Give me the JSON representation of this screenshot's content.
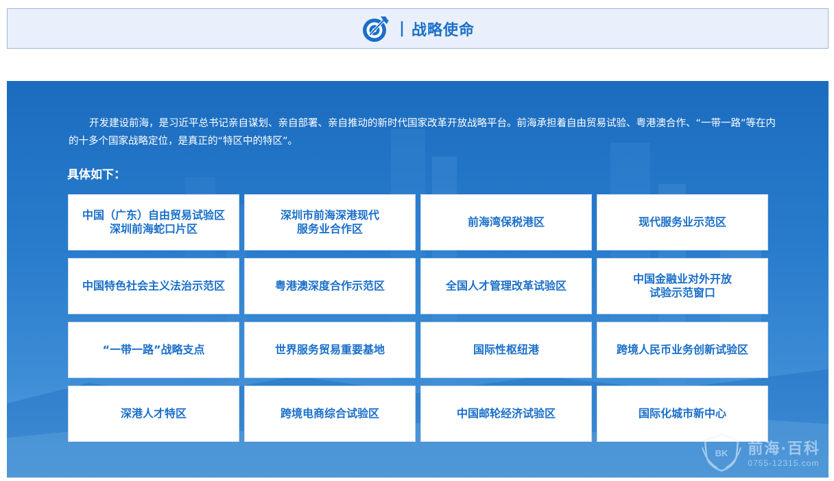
{
  "header": {
    "icon": "target-arrow-icon",
    "separator": "|",
    "title": "战略使命"
  },
  "intro": {
    "paragraph": "开发建设前海，是习近平总书记亲自谋划、亲自部署、亲自推动的新时代国家改革开放战略平台。前海承担着自由贸易试验、粤港澳合作、“一带一路”等在内的十多个国家战略定位，是真正的“特区中的特区”。"
  },
  "list_heading": "具体如下：",
  "items": [
    {
      "label": "中国（广东）自由贸易试验区\n深圳前海蛇口片区"
    },
    {
      "label": "深圳市前海深港现代\n服务业合作区"
    },
    {
      "label": "前海湾保税港区"
    },
    {
      "label": "现代服务业示范区"
    },
    {
      "label": "中国特色社会主义法治示范区"
    },
    {
      "label": "粤港澳深度合作示范区"
    },
    {
      "label": "全国人才管理改革试验区"
    },
    {
      "label": "中国金融业对外开放\n试验示范窗口"
    },
    {
      "label": "“一带一路”战略支点"
    },
    {
      "label": "世界服务贸易重要基地"
    },
    {
      "label": "国际性枢纽港"
    },
    {
      "label": "跨境人民币业务创新试验区"
    },
    {
      "label": "深港人才特区"
    },
    {
      "label": "跨境电商综合试验区"
    },
    {
      "label": "中国邮轮经济试验区"
    },
    {
      "label": "国际化城市新中心"
    }
  ],
  "watermark": {
    "badge": "BK",
    "name": "前海·百科",
    "phone": "0755-12315.com"
  },
  "colors": {
    "accent": "#1a6fc9",
    "panel": "#2a7dcd",
    "header_bg": "#eaf0fb"
  }
}
